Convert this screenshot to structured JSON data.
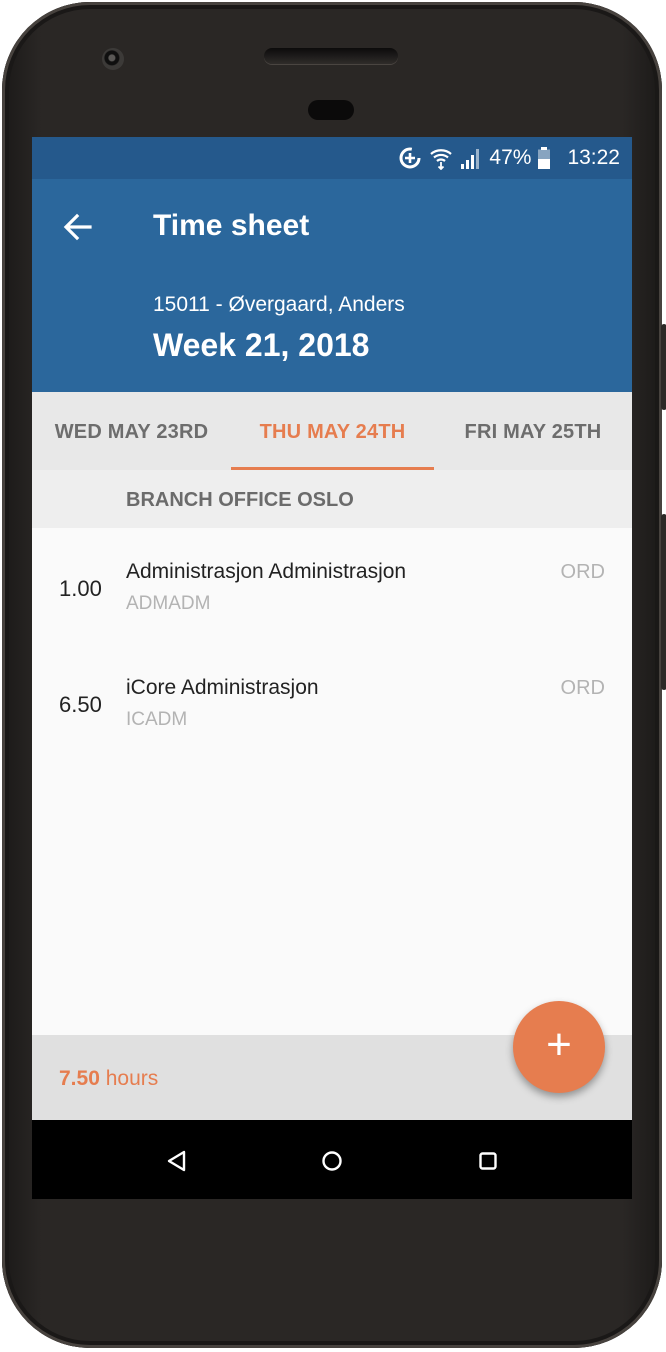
{
  "status_bar": {
    "battery": "47%",
    "time": "13:22",
    "icons": [
      "data-saver-icon",
      "wifi-icon",
      "signal-icon",
      "battery-icon"
    ]
  },
  "app_bar": {
    "title": "Time sheet",
    "subtitle": "15011 - Øvergaard, Anders",
    "week": "Week 21, 2018",
    "back_icon": "arrow-back-icon"
  },
  "tabs": [
    {
      "label": "WED MAY 23RD",
      "active": false
    },
    {
      "label": "THU MAY 24TH",
      "active": true
    },
    {
      "label": "FRI MAY 25TH",
      "active": false
    }
  ],
  "section": {
    "title": "BRANCH OFFICE OSLO"
  },
  "entries": [
    {
      "hours": "1.00",
      "name": "Administrasjon Administrasjon",
      "code": "ADMADM",
      "type": "ORD"
    },
    {
      "hours": "6.50",
      "name": "iCore Administrasjon",
      "code": "ICADM",
      "type": "ORD"
    }
  ],
  "footer": {
    "total_value": "7.50",
    "total_unit": "hours"
  },
  "fab": {
    "label": "+",
    "icon": "add-icon"
  },
  "nav_bar": {
    "icons": [
      "nav-back-icon",
      "nav-home-icon",
      "nav-recents-icon"
    ]
  },
  "colors": {
    "status_bar": "#25598c",
    "app_bar": "#2b679c",
    "accent": "#e67d4f",
    "tab_bar": "#e8e8e8",
    "footer": "#e0e0e0"
  }
}
